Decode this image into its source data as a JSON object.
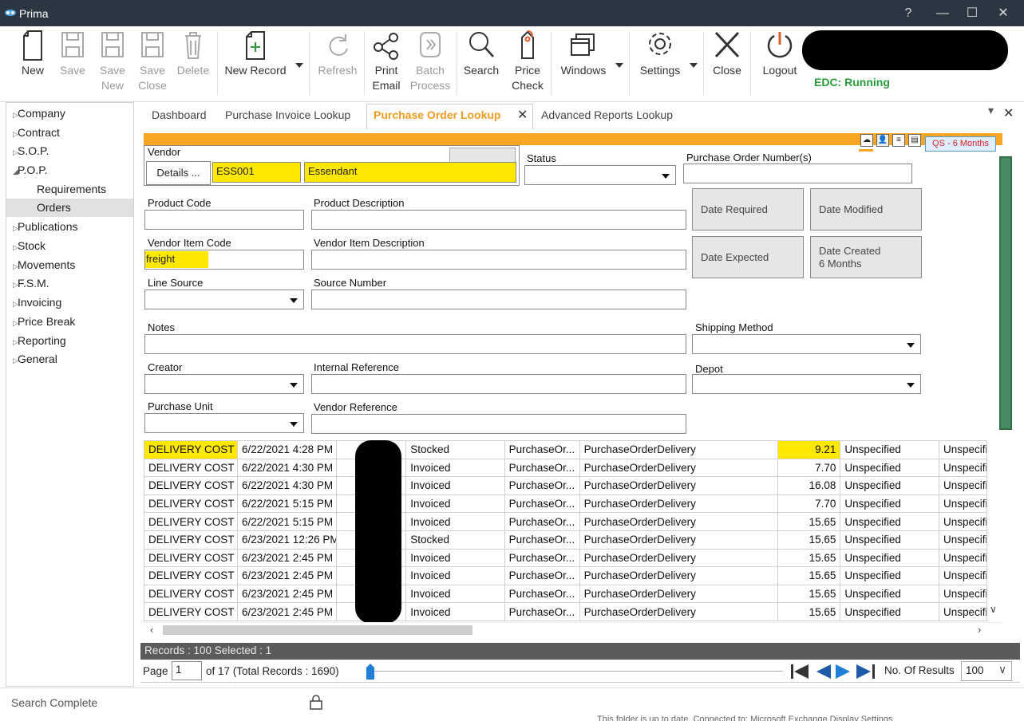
{
  "window": {
    "title": "Prima",
    "controls": [
      "?",
      "—",
      "☐",
      "✕"
    ]
  },
  "toolbar": {
    "new": "New",
    "save": "Save",
    "save_new_1": "Save",
    "save_new_2": "New",
    "save_close_1": "Save",
    "save_close_2": "Close",
    "delete": "Delete",
    "new_record": "New Record",
    "refresh": "Refresh",
    "print_email_1": "Print",
    "print_email_2": "Email",
    "batch_process_1": "Batch",
    "batch_process_2": "Process",
    "search": "Search",
    "price_check_1": "Price",
    "price_check_2": "Check",
    "windows": "Windows",
    "settings": "Settings",
    "close": "Close",
    "logout": "Logout",
    "edc_status": "EDC: Running"
  },
  "sidebar": {
    "items": [
      {
        "label": "Company",
        "tri": "▷"
      },
      {
        "label": "Contract",
        "tri": "▷"
      },
      {
        "label": "S.O.P.",
        "tri": "▷"
      },
      {
        "label": "P.O.P.",
        "tri": "◢"
      },
      {
        "label": "Requirements"
      },
      {
        "label": "Orders"
      },
      {
        "label": "Publications",
        "tri": "▷"
      },
      {
        "label": "Stock",
        "tri": "▷"
      },
      {
        "label": "Movements",
        "tri": "▷"
      },
      {
        "label": "F.S.M.",
        "tri": "▷"
      },
      {
        "label": "Invoicing",
        "tri": "▷"
      },
      {
        "label": "Price Break",
        "tri": "▷"
      },
      {
        "label": "Reporting",
        "tri": "▷"
      },
      {
        "label": "General",
        "tri": "▷"
      }
    ]
  },
  "tabs": {
    "t1": "Dashboard",
    "t2": "Purchase Invoice Lookup",
    "t3": "Purchase Order Lookup",
    "t3_close": "✕",
    "t4": "Advanced Reports Lookup",
    "pin": "▾",
    "close_all": "✕"
  },
  "form": {
    "qs_badge": "QS - 6 Months",
    "vendor_label": "Vendor",
    "details_btn": "Details ...",
    "vendor_code": "ESS001",
    "vendor_name": "Essendant",
    "status_label": "Status",
    "status_value": "",
    "po_numbers_label": "Purchase Order Number(s)",
    "po_numbers_value": "",
    "product_code_label": "Product Code",
    "product_code_value": "",
    "product_desc_label": "Product Description",
    "product_desc_value": "",
    "date_required": "Date Required",
    "date_modified": "Date Modified",
    "vendor_item_code_label": "Vendor Item Code",
    "vendor_item_code_value": "freight",
    "vendor_item_desc_label": "Vendor Item Description",
    "vendor_item_desc_value": "",
    "date_expected": "Date Expected",
    "date_created_1": "Date Created",
    "date_created_2": "6 Months",
    "line_source_label": "Line Source",
    "line_source_value": "",
    "source_number_label": "Source Number",
    "source_number_value": "",
    "notes_label": "Notes",
    "notes_value": "",
    "shipping_method_label": "Shipping Method",
    "shipping_method_value": "",
    "creator_label": "Creator",
    "creator_value": "",
    "internal_ref_label": "Internal Reference",
    "internal_ref_value": "",
    "depot_label": "Depot",
    "depot_value": "",
    "purchase_unit_label": "Purchase Unit",
    "purchase_unit_value": "",
    "vendor_ref_label": "Vendor Reference",
    "vendor_ref_value": ""
  },
  "grid": {
    "rows": [
      [
        "DELIVERY COST",
        "6/22/2021 4:28 PM",
        "",
        "Stocked",
        "PurchaseOr...",
        "PurchaseOrderDelivery",
        "9.21",
        "Unspecified",
        "Unspecifi"
      ],
      [
        "DELIVERY COST",
        "6/22/2021 4:30 PM",
        "",
        "Invoiced",
        "PurchaseOr...",
        "PurchaseOrderDelivery",
        "7.70",
        "Unspecified",
        "Unspecifi"
      ],
      [
        "DELIVERY COST",
        "6/22/2021 4:30 PM",
        "",
        "Invoiced",
        "PurchaseOr...",
        "PurchaseOrderDelivery",
        "16.08",
        "Unspecified",
        "Unspecifi"
      ],
      [
        "DELIVERY COST",
        "6/22/2021 5:15 PM",
        "",
        "Invoiced",
        "PurchaseOr...",
        "PurchaseOrderDelivery",
        "7.70",
        "Unspecified",
        "Unspecifi"
      ],
      [
        "DELIVERY COST",
        "6/22/2021 5:15 PM",
        "",
        "Invoiced",
        "PurchaseOr...",
        "PurchaseOrderDelivery",
        "15.65",
        "Unspecified",
        "Unspecifi"
      ],
      [
        "DELIVERY COST",
        "6/23/2021 12:26 PM",
        "",
        "Stocked",
        "PurchaseOr...",
        "PurchaseOrderDelivery",
        "15.65",
        "Unspecified",
        "Unspecifi"
      ],
      [
        "DELIVERY COST",
        "6/23/2021 2:45 PM",
        "",
        "Invoiced",
        "PurchaseOr...",
        "PurchaseOrderDelivery",
        "15.65",
        "Unspecified",
        "Unspecifi"
      ],
      [
        "DELIVERY COST",
        "6/23/2021 2:45 PM",
        "",
        "Invoiced",
        "PurchaseOr...",
        "PurchaseOrderDelivery",
        "15.65",
        "Unspecified",
        "Unspecifi"
      ],
      [
        "DELIVERY COST",
        "6/23/2021 2:45 PM",
        "",
        "Invoiced",
        "PurchaseOr...",
        "PurchaseOrderDelivery",
        "15.65",
        "Unspecified",
        "Unspecifi"
      ],
      [
        "DELIVERY COST",
        "6/23/2021 2:45 PM",
        "",
        "Invoiced",
        "PurchaseOr...",
        "PurchaseOrderDelivery",
        "15.65",
        "Unspecified",
        "Unspecifi"
      ]
    ],
    "records_text": "Records : 100   Selected : 1",
    "page_label": "Page",
    "page_value": "1",
    "of_text": "of  17  (Total Records : 1690)",
    "results_label": "No. Of Results",
    "results_value": "100"
  },
  "status": {
    "text": "Search Complete",
    "bg_text": "This folder is up to date.      Connected to: Microsoft Exchange      Display Settings"
  }
}
